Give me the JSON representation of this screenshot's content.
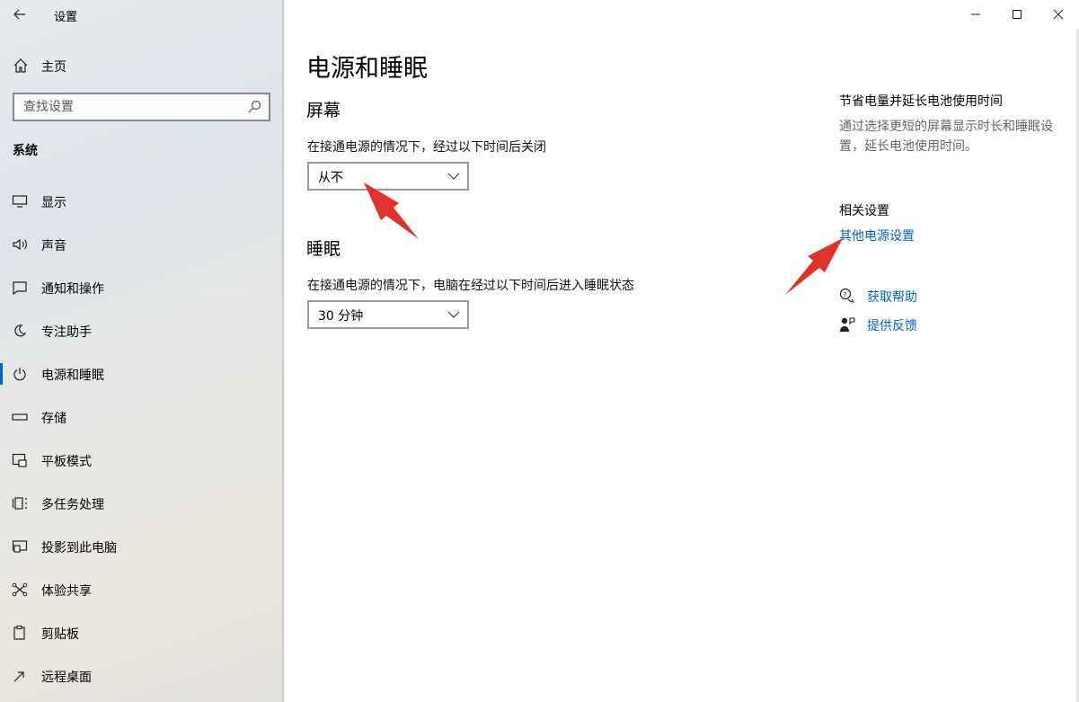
{
  "window": {
    "title": "设置"
  },
  "sidebar": {
    "home_label": "主页",
    "search_placeholder": "查找设置",
    "section_title": "系统",
    "items": [
      {
        "label": "显示",
        "icon": "monitor-icon"
      },
      {
        "label": "声音",
        "icon": "speaker-icon"
      },
      {
        "label": "通知和操作",
        "icon": "notification-icon"
      },
      {
        "label": "专注助手",
        "icon": "moon-icon"
      },
      {
        "label": "电源和睡眠",
        "icon": "power-icon",
        "active": true
      },
      {
        "label": "存储",
        "icon": "storage-icon"
      },
      {
        "label": "平板模式",
        "icon": "tablet-icon"
      },
      {
        "label": "多任务处理",
        "icon": "multitask-icon"
      },
      {
        "label": "投影到此电脑",
        "icon": "project-icon"
      },
      {
        "label": "体验共享",
        "icon": "share-icon"
      },
      {
        "label": "剪贴板",
        "icon": "clipboard-icon"
      },
      {
        "label": "远程桌面",
        "icon": "remote-icon"
      }
    ]
  },
  "main": {
    "title": "电源和睡眠",
    "screen": {
      "heading": "屏幕",
      "desc": "在接通电源的情况下，经过以下时间后关闭",
      "value": "从不"
    },
    "sleep": {
      "heading": "睡眠",
      "desc": "在接通电源的情况下，电脑在经过以下时间后进入睡眠状态",
      "value": "30 分钟"
    }
  },
  "right": {
    "tip_title": "节省电量并延长电池使用时间",
    "tip_desc": "通过选择更短的屏幕显示时长和睡眠设置，延长电池使用时间。",
    "related_title": "相关设置",
    "related_link": "其他电源设置",
    "help_label": "获取帮助",
    "feedback_label": "提供反馈"
  },
  "colors": {
    "accent": "#0067c0",
    "annotation_arrow": "#e0312b"
  }
}
